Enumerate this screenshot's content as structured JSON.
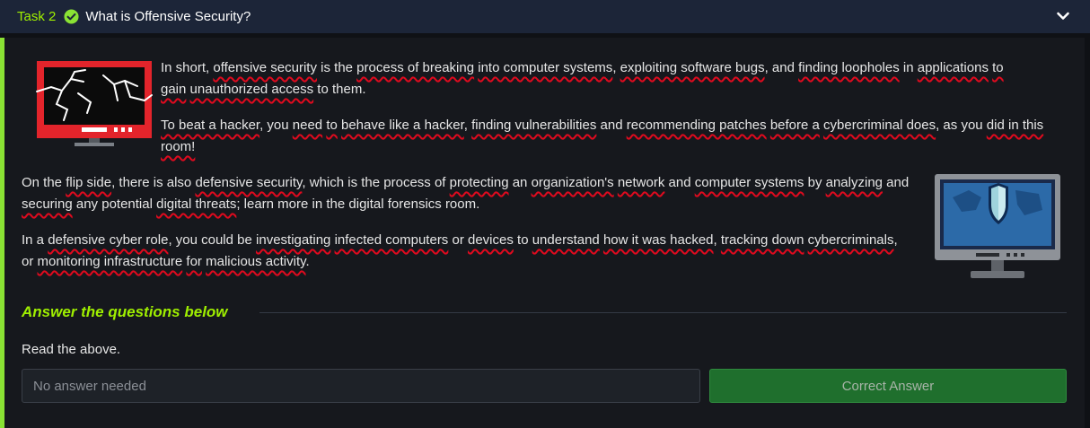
{
  "header": {
    "task_label": "Task 2",
    "title": "What is Offensive Security?",
    "status": "completed",
    "icons": {
      "status": "check-circle-icon",
      "toggle": "chevron-down-icon"
    },
    "colors": {
      "accent": "#9fef00",
      "header_bg": "#1c2538"
    }
  },
  "content": {
    "paragraphs": [
      [
        "In short, ",
        {
          "t": "offensive security",
          "u": 1
        },
        " is the ",
        {
          "t": "process of breaking",
          "u": 1
        },
        " ",
        {
          "t": "into computer systems",
          "u": 1
        },
        ", ",
        {
          "t": "exploiting software bugs",
          "u": 1
        },
        ", and ",
        {
          "t": "finding loopholes",
          "u": 1
        },
        " in ",
        {
          "t": "applications",
          "u": 1
        },
        " ",
        {
          "t": "to gain",
          "u": 1
        },
        " ",
        {
          "t": "unauthorized access",
          "u": 1
        },
        " to them."
      ],
      [
        {
          "t": "To beat a hacker",
          "u": 1
        },
        ", you ",
        {
          "t": "need",
          "u": 1
        },
        " ",
        {
          "t": "to",
          "u": 1
        },
        " ",
        {
          "t": "behave like a hacker",
          "u": 1
        },
        ", ",
        {
          "t": "finding vulnerabilities",
          "u": 1
        },
        " and ",
        {
          "t": "recommending patches",
          "u": 1
        },
        " ",
        {
          "t": "before a",
          "u": 1
        },
        " ",
        {
          "t": "cybercriminal does",
          "u": 1
        },
        ", as you ",
        {
          "t": "did in this room!",
          "u": 1
        }
      ],
      [
        "On the ",
        {
          "t": "flip side",
          "u": 1
        },
        ", there is also ",
        {
          "t": "defensive security",
          "u": 1
        },
        ", which is the process of ",
        {
          "t": "protecting",
          "u": 1
        },
        " an ",
        {
          "t": "organization's",
          "u": 1
        },
        " ",
        {
          "t": "network",
          "u": 1
        },
        " and ",
        {
          "t": "computer systems",
          "u": 1
        },
        " by ",
        {
          "t": "analyzing",
          "u": 1
        },
        " and ",
        {
          "t": "securing",
          "u": 1
        },
        " any potential ",
        {
          "t": "digital threats",
          "u": 1
        },
        "; learn more in the digital forensics room."
      ],
      [
        "In a ",
        {
          "t": "defensive cyber role",
          "u": 1
        },
        ", you could be ",
        {
          "t": "investigating",
          "u": 1
        },
        " ",
        {
          "t": "infected computers",
          "u": 1
        },
        " or ",
        {
          "t": "devices",
          "u": 1
        },
        " to ",
        {
          "t": "understand",
          "u": 1
        },
        " ",
        {
          "t": "how it was hacked",
          "u": 1
        },
        ", ",
        {
          "t": "tracking down",
          "u": 1
        },
        " ",
        {
          "t": "cybercriminals",
          "u": 1
        },
        ", or ",
        {
          "t": "monitoring infrastructure",
          "u": 1
        },
        " ",
        {
          "t": "for",
          "u": 1
        },
        " ",
        {
          "t": "malicious activity",
          "u": 1
        },
        "."
      ]
    ],
    "images": {
      "hacked": "hacked-monitor-icon",
      "defense": "shield-monitor-icon"
    }
  },
  "questions": {
    "heading": "Answer the questions below",
    "items": [
      {
        "text": "Read the above.",
        "placeholder": "No answer needed",
        "button_label": "Correct Answer"
      }
    ]
  }
}
